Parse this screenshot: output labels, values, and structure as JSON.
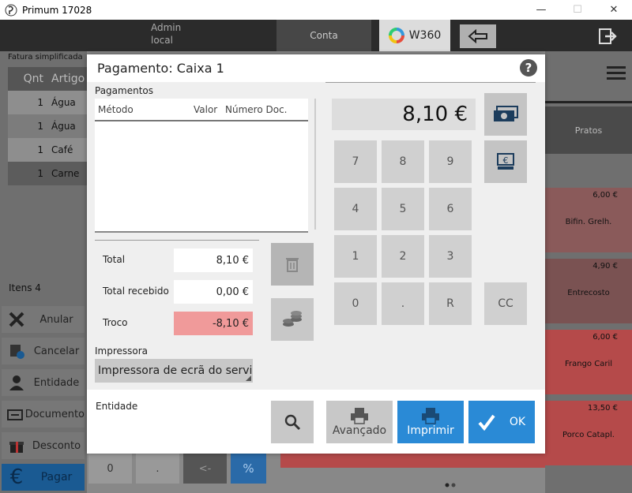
{
  "window": {
    "title": "Primum 17028",
    "minimize": "—",
    "maximize": "☐",
    "close": "✕"
  },
  "topbar": {
    "user_line1": "Admin",
    "user_line2": "local",
    "conta": "Conta",
    "terminal": "W360"
  },
  "background": {
    "fatura": "Fatura simplificada",
    "header_qnt": "Qnt",
    "header_artigo": "Artigo",
    "rows": [
      {
        "qty": "1",
        "name": "Água"
      },
      {
        "qty": "1",
        "name": "Água"
      },
      {
        "qty": "1",
        "name": "Café"
      },
      {
        "qty": "1",
        "name": "Carne"
      }
    ],
    "itens": "Itens 4",
    "side_buttons": [
      "Anular",
      "Cancelar",
      "Entidade",
      "Documento",
      "Desconto",
      "Pagar"
    ],
    "pratos": "Pratos",
    "products": [
      {
        "price": "6,00 €",
        "name": "Bifin. Grelh."
      },
      {
        "price": "4,90 €",
        "name": "Entrecosto"
      },
      {
        "price": "6,00 €",
        "name": "Frango Caril"
      },
      {
        "price": "13,50 €",
        "name": "Porco Catapl."
      }
    ],
    "bottom_keys": [
      "0",
      ".",
      "<-",
      "%"
    ]
  },
  "dialog": {
    "title": "Pagamento: Caixa 1",
    "help": "?",
    "payments_label": "Pagamentos",
    "columns": {
      "method": "Método",
      "value": "Valor",
      "doc": "Número Doc."
    },
    "total_label": "Total",
    "total_value": "8,10 €",
    "received_label": "Total recebido",
    "received_value": "0,00 €",
    "change_label": "Troco",
    "change_value": "-8,10 €",
    "printer_label": "Impressora",
    "printer_value": "Impressora de ecrã do serviço",
    "amount": "8,10 €",
    "keys": [
      "7",
      "8",
      "9",
      "4",
      "5",
      "6",
      "1",
      "2",
      "3",
      "0",
      ".",
      "R"
    ],
    "cc": "CC",
    "entity_label": "Entidade",
    "advanced": "Avançado",
    "print": "Imprimir",
    "ok": "OK"
  },
  "colors": {
    "accent": "#2a8ad6",
    "change_bg": "#f09a9a",
    "header_bg": "#2b2b2b"
  }
}
